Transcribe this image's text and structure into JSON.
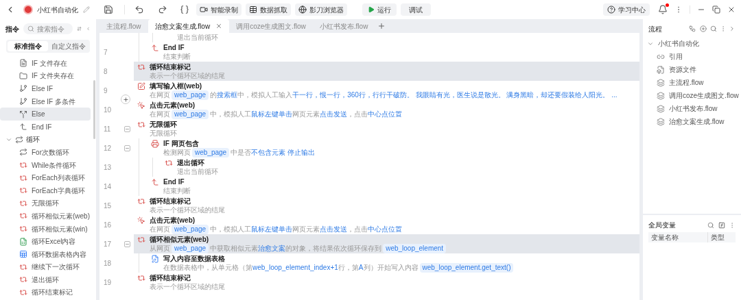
{
  "app": {
    "title": "小红书自动化",
    "buttons": [
      {
        "kind": "record",
        "label": "智能录制"
      },
      {
        "kind": "grab",
        "label": "数据抓取"
      },
      {
        "kind": "browser",
        "label": "影刀浏览器"
      }
    ],
    "run": "运行",
    "debug": "调试",
    "help": "学习中心",
    "has_notification": true
  },
  "commands": {
    "title": "指令",
    "search_placeholder": "搜索指令",
    "tabs": [
      {
        "label": "标准指令",
        "selected": true
      },
      {
        "label": "自定义指令",
        "selected": false
      }
    ],
    "items": [
      {
        "kind": "hidden",
        "children": [
          {
            "kind": "file_if",
            "label": "IF 文件存在",
            "selected": false
          },
          {
            "kind": "folder_if",
            "label": "IF 文件夹存在",
            "selected": false
          },
          {
            "kind": "branch",
            "label": "Else IF",
            "selected": false
          },
          {
            "kind": "branch",
            "label": "Else IF 多条件",
            "selected": false
          },
          {
            "kind": "else",
            "label": "Else",
            "selected": true
          },
          {
            "kind": "end_if",
            "label": "End IF",
            "selected": false
          }
        ]
      },
      {
        "kind": "group",
        "label": "循环",
        "expanded": true,
        "children": [
          {
            "kind": "for",
            "label": "For次数循环",
            "selected": false
          },
          {
            "kind": "loop",
            "label": "While条件循环",
            "selected": false
          },
          {
            "kind": "loop",
            "label": "ForEach列表循环",
            "selected": false
          },
          {
            "kind": "loop",
            "label": "ForEach字典循环",
            "selected": false
          },
          {
            "kind": "loop",
            "label": "无限循环",
            "selected": false
          },
          {
            "kind": "loop",
            "label": "循环相似元素(web)",
            "selected": false
          },
          {
            "kind": "loop",
            "label": "循环相似元素(win)",
            "selected": false
          },
          {
            "kind": "excel",
            "label": "循环Excel内容",
            "selected": false
          },
          {
            "kind": "table",
            "label": "循环数据表格内容",
            "selected": false
          },
          {
            "kind": "loop",
            "label": "继续下一次循环",
            "selected": false
          },
          {
            "kind": "loop",
            "label": "退出循环",
            "selected": false
          },
          {
            "kind": "loop",
            "label": "循环结束标记",
            "selected": false
          }
        ]
      }
    ]
  },
  "tabs": [
    {
      "label": "主流程.flow",
      "selected": false
    },
    {
      "label": "治愈文案生成.flow",
      "selected": true
    },
    {
      "label": "调用coze生成图文.flow",
      "selected": false
    },
    {
      "label": "小红书发布.flow",
      "selected": false
    }
  ],
  "steps": [
    {
      "kind": "hidden",
      "children": [
        {
          "kind": "hidden",
          "children": [
            {
              "kind": "tail",
              "desc": [
                {
                  "kind": "text",
                  "text": "退出当前循环"
                }
              ]
            }
          ]
        },
        {
          "line": "7",
          "kind": "end_if",
          "title": "End IF",
          "desc": [
            {
              "kind": "text",
              "text": "结束判断"
            }
          ],
          "selected": false
        }
      ]
    },
    {
      "line": "8",
      "kind": "loop",
      "title": "循环结束标记",
      "desc": [
        {
          "kind": "text",
          "text": "表示一个循环区域的结尾"
        }
      ],
      "selected": true
    },
    {
      "line": "9",
      "kind": "input",
      "title": "填写输入框(web)",
      "desc": [
        {
          "kind": "text",
          "text": "在网页"
        },
        {
          "kind": "var",
          "text": "web_page"
        },
        {
          "kind": "text",
          "text": "的"
        },
        {
          "kind": "link",
          "text": "搜索框"
        },
        {
          "kind": "text",
          "text": "中，模拟人工输入"
        },
        {
          "kind": "link",
          "text": "干一行，恨一行，360行，行行干破防。 我眼睛有光，医生说是散光。 满身黑暗，却还要假装给人阳光。 ..."
        }
      ],
      "selected": false
    },
    {
      "line": "10",
      "kind": "click",
      "title": "点击元素(web)",
      "insert_handle": true,
      "desc": [
        {
          "kind": "text",
          "text": "在网页"
        },
        {
          "kind": "var",
          "text": "web_page"
        },
        {
          "kind": "text",
          "text": "中，模拟人工"
        },
        {
          "kind": "link",
          "text": "鼠标左键单击"
        },
        {
          "kind": "text",
          "text": "网页元素"
        },
        {
          "kind": "link",
          "text": "点击发送"
        },
        {
          "kind": "text",
          "text": "，点击"
        },
        {
          "kind": "link",
          "text": "中心点位置"
        }
      ],
      "selected": false
    },
    {
      "line": "11",
      "kind": "loop",
      "title": "无限循环",
      "expanded": true,
      "desc": [
        {
          "kind": "text",
          "text": "无限循环"
        }
      ],
      "selected": false,
      "children": [
        {
          "line": "12",
          "kind": "if",
          "title": "IF 网页包含",
          "expanded": true,
          "desc": [
            {
              "kind": "text",
              "text": "检测网页"
            },
            {
              "kind": "var",
              "text": "web_page"
            },
            {
              "kind": "text",
              "text": "中是否"
            },
            {
              "kind": "link",
              "text": "不包含元素 停止输出"
            }
          ],
          "selected": false,
          "children": [
            {
              "line": "13",
              "kind": "loop",
              "title": "退出循环",
              "desc": [
                {
                  "kind": "text",
                  "text": "退出当前循环"
                }
              ],
              "selected": false
            }
          ]
        },
        {
          "line": "14",
          "kind": "end_if",
          "title": "End IF",
          "desc": [
            {
              "kind": "text",
              "text": "结束判断"
            }
          ],
          "selected": false
        }
      ]
    },
    {
      "line": "15",
      "kind": "loop",
      "title": "循环结束标记",
      "desc": [
        {
          "kind": "text",
          "text": "表示一个循环区域的结尾"
        }
      ],
      "selected": false
    },
    {
      "line": "16",
      "kind": "click",
      "title": "点击元素(web)",
      "desc": [
        {
          "kind": "text",
          "text": "在网页"
        },
        {
          "kind": "var",
          "text": "web_page"
        },
        {
          "kind": "text",
          "text": "中，模拟人工"
        },
        {
          "kind": "link",
          "text": "鼠标左键单击"
        },
        {
          "kind": "text",
          "text": "网页元素"
        },
        {
          "kind": "link",
          "text": "点击发送"
        },
        {
          "kind": "text",
          "text": "，点击"
        },
        {
          "kind": "link",
          "text": "中心点位置"
        }
      ],
      "selected": false
    },
    {
      "line": "17",
      "kind": "loop",
      "title": "循环相似元素(web)",
      "expanded": true,
      "desc": [
        {
          "kind": "text",
          "text": "从网页"
        },
        {
          "kind": "var",
          "text": "web_page"
        },
        {
          "kind": "text",
          "text": "中获取相似元素"
        },
        {
          "kind": "link",
          "text": "治愈文案"
        },
        {
          "kind": "text",
          "text": "的对象，将结果依次循环保存到"
        },
        {
          "kind": "var",
          "text": "web_loop_element"
        }
      ],
      "selected": true,
      "children": [
        {
          "line": "18",
          "kind": "write",
          "title": "写入内容至数据表格",
          "desc": [
            {
              "kind": "text",
              "text": "在数据表格中，从单元格（第"
            },
            {
              "kind": "link",
              "text": "web_loop_element_index+1"
            },
            {
              "kind": "text",
              "text": "行，第"
            },
            {
              "kind": "link",
              "text": "A"
            },
            {
              "kind": "text",
              "text": "列）开始写入内容"
            },
            {
              "kind": "var",
              "text": "web_loop_element.get_text()"
            }
          ],
          "selected": false
        }
      ]
    },
    {
      "line": "19",
      "kind": "loop",
      "title": "循环结束标记",
      "desc": [
        {
          "kind": "text",
          "text": "表示一个循环区域的结尾"
        }
      ],
      "selected": false
    }
  ],
  "flow_panel": {
    "title": "流程",
    "tree": [
      {
        "label": "小红书自动化",
        "expanded": true,
        "children": [
          {
            "kind": "ref",
            "label": "引用"
          },
          {
            "kind": "resource",
            "label": "资源文件"
          },
          {
            "kind": "flow",
            "label": "主流程.flow"
          },
          {
            "kind": "flow",
            "label": "调用coze生成图文.flow"
          },
          {
            "kind": "flow",
            "label": "小红书发布.flow"
          },
          {
            "kind": "flow",
            "label": "治愈文案生成.flow"
          }
        ]
      }
    ]
  },
  "variables": {
    "title": "全局变量",
    "columns": [
      "变量名称",
      "类型"
    ]
  }
}
